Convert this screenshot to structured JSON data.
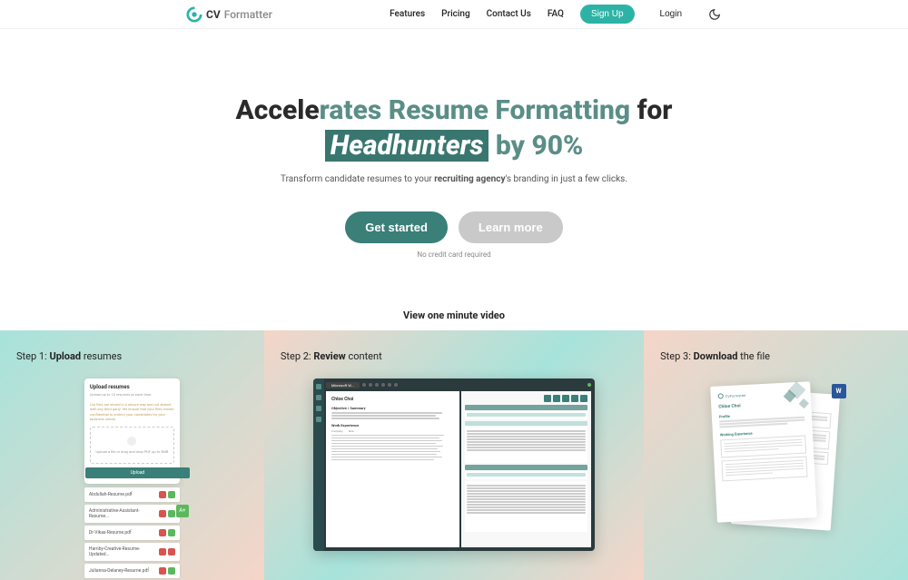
{
  "header": {
    "brand_prefix": "CV",
    "brand_suffix": "Formatter",
    "nav": {
      "features": "Features",
      "pricing": "Pricing",
      "contact": "Contact Us",
      "faq": "FAQ"
    },
    "signup": "Sign Up",
    "login": "Login"
  },
  "hero": {
    "line1_a": "Accele",
    "line1_b": "rates Resume ",
    "line1_c": "Formatting",
    "line1_d": " for",
    "line2_a": "Headhunters",
    "line2_b": " by 90%",
    "sub_a": "Transform candidate resumes to your ",
    "sub_b": "recruiting agency",
    "sub_c": "'s branding in just a few clicks.",
    "get_started": "Get started",
    "learn_more": "Learn more",
    "no_cc": "No credit card required"
  },
  "video_label": "View one minute video",
  "steps": {
    "s1_prefix": "Step 1: ",
    "s1_bold": "Upload",
    "s1_suffix": " resumes",
    "s2_prefix": "Step 2: ",
    "s2_bold": "Review",
    "s2_suffix": " content",
    "s3_prefix": "Step 3: ",
    "s3_bold": "Download",
    "s3_suffix": " the file"
  },
  "upload_mock": {
    "title": "Upload resumes",
    "desc": "Upload up to 10 resumes at each time.",
    "note": "Our files are stored in a secure way and not shared with any third party. We ensure that your files remain confidential to protect your candidates for your business needs.",
    "dropzone": "Upload a file or drag and drop PDF up to 5MB",
    "upload_btn": "Upload",
    "files": [
      "Abdullah-Resume.pdf",
      "Administrative-Assistant-Resume...",
      "Dr-Vikas-Resume.pdf",
      "Hamby-Creative-Resume-Updated...",
      "Julianna-Delaney-Resume.pdf"
    ]
  },
  "review_mock": {
    "toolbar_label": "Microsoft W...",
    "name": "Chloe Choi",
    "heading1": "Objective / Summary",
    "heading2": "Work Experience",
    "right_label1": "Personal Details",
    "right_label2": "Work Experience"
  },
  "download_mock": {
    "logo_text": "CVFormatter",
    "name": "Chloe Choi",
    "label_profile": "Profile",
    "label_work": "Working Experience",
    "word_badge": "W"
  }
}
